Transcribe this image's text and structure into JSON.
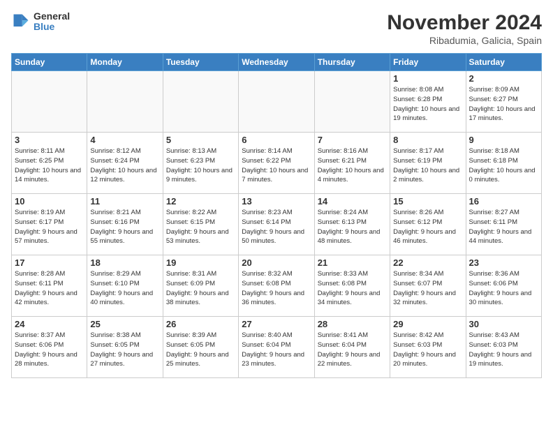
{
  "header": {
    "logo_line1": "General",
    "logo_line2": "Blue",
    "month_title": "November 2024",
    "location": "Ribadumia, Galicia, Spain"
  },
  "weekdays": [
    "Sunday",
    "Monday",
    "Tuesday",
    "Wednesday",
    "Thursday",
    "Friday",
    "Saturday"
  ],
  "weeks": [
    [
      {
        "day": "",
        "info": ""
      },
      {
        "day": "",
        "info": ""
      },
      {
        "day": "",
        "info": ""
      },
      {
        "day": "",
        "info": ""
      },
      {
        "day": "",
        "info": ""
      },
      {
        "day": "1",
        "info": "Sunrise: 8:08 AM\nSunset: 6:28 PM\nDaylight: 10 hours and 19 minutes."
      },
      {
        "day": "2",
        "info": "Sunrise: 8:09 AM\nSunset: 6:27 PM\nDaylight: 10 hours and 17 minutes."
      }
    ],
    [
      {
        "day": "3",
        "info": "Sunrise: 8:11 AM\nSunset: 6:25 PM\nDaylight: 10 hours and 14 minutes."
      },
      {
        "day": "4",
        "info": "Sunrise: 8:12 AM\nSunset: 6:24 PM\nDaylight: 10 hours and 12 minutes."
      },
      {
        "day": "5",
        "info": "Sunrise: 8:13 AM\nSunset: 6:23 PM\nDaylight: 10 hours and 9 minutes."
      },
      {
        "day": "6",
        "info": "Sunrise: 8:14 AM\nSunset: 6:22 PM\nDaylight: 10 hours and 7 minutes."
      },
      {
        "day": "7",
        "info": "Sunrise: 8:16 AM\nSunset: 6:21 PM\nDaylight: 10 hours and 4 minutes."
      },
      {
        "day": "8",
        "info": "Sunrise: 8:17 AM\nSunset: 6:19 PM\nDaylight: 10 hours and 2 minutes."
      },
      {
        "day": "9",
        "info": "Sunrise: 8:18 AM\nSunset: 6:18 PM\nDaylight: 10 hours and 0 minutes."
      }
    ],
    [
      {
        "day": "10",
        "info": "Sunrise: 8:19 AM\nSunset: 6:17 PM\nDaylight: 9 hours and 57 minutes."
      },
      {
        "day": "11",
        "info": "Sunrise: 8:21 AM\nSunset: 6:16 PM\nDaylight: 9 hours and 55 minutes."
      },
      {
        "day": "12",
        "info": "Sunrise: 8:22 AM\nSunset: 6:15 PM\nDaylight: 9 hours and 53 minutes."
      },
      {
        "day": "13",
        "info": "Sunrise: 8:23 AM\nSunset: 6:14 PM\nDaylight: 9 hours and 50 minutes."
      },
      {
        "day": "14",
        "info": "Sunrise: 8:24 AM\nSunset: 6:13 PM\nDaylight: 9 hours and 48 minutes."
      },
      {
        "day": "15",
        "info": "Sunrise: 8:26 AM\nSunset: 6:12 PM\nDaylight: 9 hours and 46 minutes."
      },
      {
        "day": "16",
        "info": "Sunrise: 8:27 AM\nSunset: 6:11 PM\nDaylight: 9 hours and 44 minutes."
      }
    ],
    [
      {
        "day": "17",
        "info": "Sunrise: 8:28 AM\nSunset: 6:11 PM\nDaylight: 9 hours and 42 minutes."
      },
      {
        "day": "18",
        "info": "Sunrise: 8:29 AM\nSunset: 6:10 PM\nDaylight: 9 hours and 40 minutes."
      },
      {
        "day": "19",
        "info": "Sunrise: 8:31 AM\nSunset: 6:09 PM\nDaylight: 9 hours and 38 minutes."
      },
      {
        "day": "20",
        "info": "Sunrise: 8:32 AM\nSunset: 6:08 PM\nDaylight: 9 hours and 36 minutes."
      },
      {
        "day": "21",
        "info": "Sunrise: 8:33 AM\nSunset: 6:08 PM\nDaylight: 9 hours and 34 minutes."
      },
      {
        "day": "22",
        "info": "Sunrise: 8:34 AM\nSunset: 6:07 PM\nDaylight: 9 hours and 32 minutes."
      },
      {
        "day": "23",
        "info": "Sunrise: 8:36 AM\nSunset: 6:06 PM\nDaylight: 9 hours and 30 minutes."
      }
    ],
    [
      {
        "day": "24",
        "info": "Sunrise: 8:37 AM\nSunset: 6:06 PM\nDaylight: 9 hours and 28 minutes."
      },
      {
        "day": "25",
        "info": "Sunrise: 8:38 AM\nSunset: 6:05 PM\nDaylight: 9 hours and 27 minutes."
      },
      {
        "day": "26",
        "info": "Sunrise: 8:39 AM\nSunset: 6:05 PM\nDaylight: 9 hours and 25 minutes."
      },
      {
        "day": "27",
        "info": "Sunrise: 8:40 AM\nSunset: 6:04 PM\nDaylight: 9 hours and 23 minutes."
      },
      {
        "day": "28",
        "info": "Sunrise: 8:41 AM\nSunset: 6:04 PM\nDaylight: 9 hours and 22 minutes."
      },
      {
        "day": "29",
        "info": "Sunrise: 8:42 AM\nSunset: 6:03 PM\nDaylight: 9 hours and 20 minutes."
      },
      {
        "day": "30",
        "info": "Sunrise: 8:43 AM\nSunset: 6:03 PM\nDaylight: 9 hours and 19 minutes."
      }
    ]
  ]
}
